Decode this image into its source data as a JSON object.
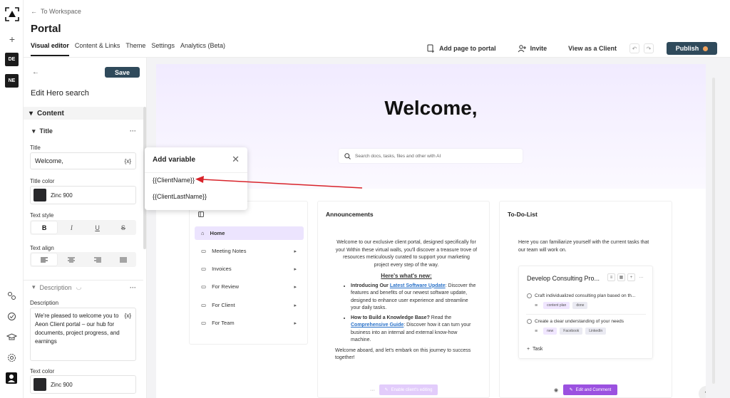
{
  "header": {
    "back_label": "To Workspace",
    "title": "Portal",
    "tabs": [
      {
        "label": "Visual editor",
        "active": true
      },
      {
        "label": "Content & Links"
      },
      {
        "label": "Theme"
      },
      {
        "label": "Settings"
      },
      {
        "label": "Analytics (Beta)"
      }
    ],
    "actions": {
      "add_page": "Add page to portal",
      "invite": "Invite",
      "view_as_client": "View as a Client",
      "publish": "Publish"
    }
  },
  "rail": {
    "workspaces": [
      "DE",
      "NE"
    ]
  },
  "editor": {
    "save_label": "Save",
    "title": "Edit Hero search",
    "content_section": "Content",
    "title_group": "Title",
    "title_field_label": "Title",
    "title_value": "Welcome,",
    "var_token": "{x}",
    "title_color_label": "Title color",
    "title_color_value": "Zinc 900",
    "text_style_label": "Text style",
    "text_style_buttons": [
      "B",
      "I",
      "U",
      "S"
    ],
    "text_align_label": "Text align",
    "description_group": "Description",
    "description_field_label": "Description",
    "description_value": "We're pleased to welcome you to Aeon Client portal – our hub for documents, project progress, and earnings",
    "text_color_label": "Text color",
    "text_color_value": "Zinc 900",
    "more_label": "···"
  },
  "popover": {
    "title": "Add variable",
    "options": [
      "{{ClientName}}",
      "{{ClientLastName}}"
    ]
  },
  "preview": {
    "hero_title": "Welcome,",
    "search_placeholder": "Search docs, tasks, files and other with AI",
    "nav_items": [
      {
        "label": "Home",
        "active": true
      },
      {
        "label": "Meeting Notes"
      },
      {
        "label": "Invoices"
      },
      {
        "label": "For Review"
      },
      {
        "label": "For Client"
      },
      {
        "label": "For Team"
      }
    ],
    "announcements": {
      "title": "Announcements",
      "intro": "Welcome to our exclusive client portal, designed specifically for you! Within these virtual walls, you'll discover a treasure trove of resources meticulously curated to support your marketing project every step of the way.",
      "heading": "Here's what's new:",
      "item1_lead": "Introducing Our ",
      "item1_link": "Latest Software Update",
      "item1_rest": ": Discover the features and benefits of our newest software update, designed to enhance user experience and streamline your daily tasks.",
      "item2_lead": "How to Build a Knowledge Base?",
      "item2_mid": " Read the ",
      "item2_link": "Comprehensive Guide",
      "item2_rest": ": Discover how it can turn your business into an internal and external know-how machine.",
      "outro": "Welcome aboard, and let's embark on this journey to success together!",
      "footer_more": "···",
      "footer_button": "Enable client's editing"
    },
    "todo": {
      "title": "To-Do-List",
      "intro": "Here you can familiarize yourself with the current tasks that our team will work on.",
      "list_title": "Develop Consulting Pro...",
      "tasks": [
        {
          "label": "Craft individualized consulting plan based on th...",
          "tags": [
            "content plan",
            "done"
          ]
        },
        {
          "label": "Create a clear understanding of your needs",
          "tags": [
            "new",
            "Facebook",
            "LinkedIn"
          ]
        }
      ],
      "add_task": "Task",
      "footer_button": "Edit and Comment"
    }
  },
  "colors": {
    "accent": "#2f4a5b",
    "arrow": "#d8232a",
    "purple": "#9b51e0"
  }
}
